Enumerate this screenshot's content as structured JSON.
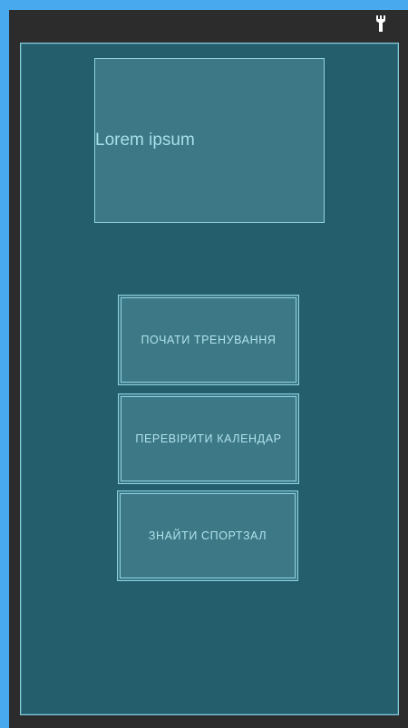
{
  "toolbar": {
    "icon": "wrench-icon",
    "icon_color": "#ffffff"
  },
  "colors": {
    "background": "#48a9ef",
    "frame": "#2c2c2c",
    "screen": "#245e6c",
    "element_fill": "#3c7886",
    "outline": "#8fd2e2",
    "text": "#b2e2ec"
  },
  "image_placeholder": {
    "text": "Lorem ipsum"
  },
  "buttons": [
    {
      "label": "ПОЧАТИ ТРЕНУВАННЯ"
    },
    {
      "label": "ПЕРЕВІРИТИ КАЛЕНДАР"
    },
    {
      "label": "ЗНАЙТИ СПОРТЗАЛ"
    }
  ]
}
